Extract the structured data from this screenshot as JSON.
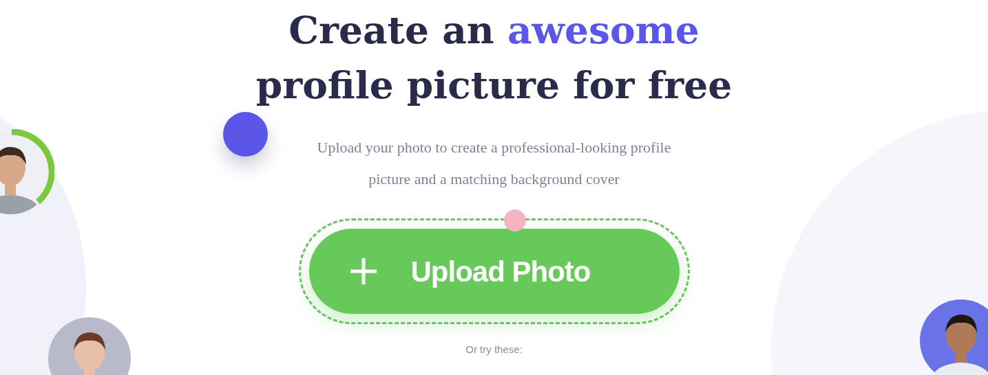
{
  "hero": {
    "heading": {
      "before": "Create an",
      "highlight": "awesome",
      "after": "profile picture for free"
    },
    "subtitle": "Upload your photo to create a professional-looking profile picture and a matching background cover",
    "upload_button": {
      "label": "Upload Photo"
    },
    "try_label": "Or try these:"
  }
}
